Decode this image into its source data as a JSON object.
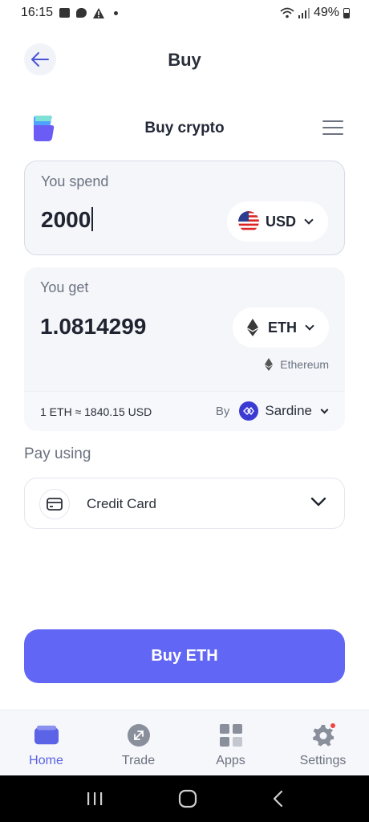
{
  "status_bar": {
    "time": "16:15",
    "battery": "49%"
  },
  "header": {
    "title": "Buy"
  },
  "widget": {
    "title": "Buy crypto"
  },
  "spend": {
    "label": "You spend",
    "amount": "2000",
    "currency": "USD"
  },
  "get": {
    "label": "You get",
    "amount": "1.0814299",
    "token": "ETH",
    "network": "Ethereum",
    "rate": "1 ETH ≈ 1840.15 USD",
    "provider_prefix": "By",
    "provider": "Sardine"
  },
  "payment": {
    "label": "Pay using",
    "method": "Credit Card"
  },
  "buy_button": {
    "label": "Buy ETH",
    "color": "#6166f5"
  },
  "bottom_nav": {
    "items": [
      {
        "label": "Home",
        "icon": "wallet-icon",
        "active": true
      },
      {
        "label": "Trade",
        "icon": "trade-icon",
        "active": false
      },
      {
        "label": "Apps",
        "icon": "apps-icon",
        "active": false
      },
      {
        "label": "Settings",
        "icon": "gear-icon",
        "active": false,
        "badge": true
      }
    ]
  },
  "colors": {
    "accent": "#6166f5",
    "active_nav": "#5b63e6",
    "card_bg": "#f4f6fa",
    "badge": "#ef4444"
  }
}
